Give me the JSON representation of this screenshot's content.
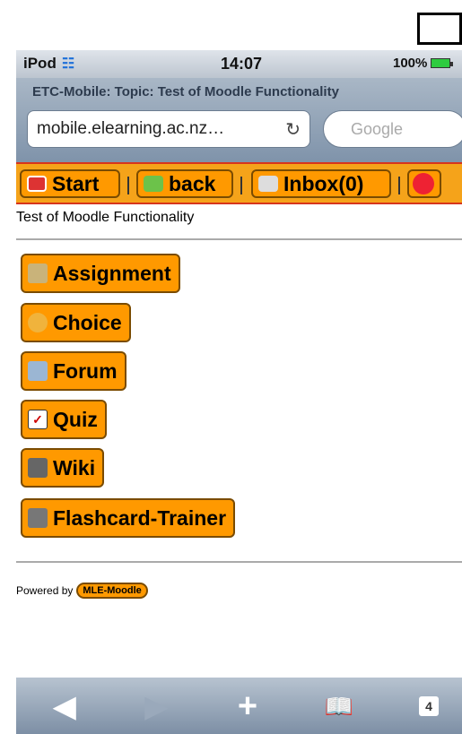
{
  "status_bar": {
    "carrier": "iPod",
    "time": "14:07",
    "battery": "100%"
  },
  "browser": {
    "page_title": "ETC-Mobile: Topic: Test of Moodle Functionality",
    "url": "mobile.elearning.ac.nz…",
    "search_placeholder": "Google"
  },
  "nav": {
    "start": "Start",
    "back": "back",
    "inbox": "Inbox(0)"
  },
  "subtitle": "Test of Moodle Functionality",
  "modules": [
    {
      "label": "Assignment",
      "icon": "assignment-icon",
      "color": "#c9b37a"
    },
    {
      "label": "Choice",
      "icon": "choice-icon",
      "color": "#f0b33c"
    },
    {
      "label": "Forum",
      "icon": "forum-icon",
      "color": "#9bb6d3"
    },
    {
      "label": "Quiz",
      "icon": "quiz-icon",
      "color": "#ffffff"
    },
    {
      "label": "Wiki",
      "icon": "wiki-icon",
      "color": "#666666"
    },
    {
      "label": "Flashcard-Trainer",
      "icon": "flashcard-icon",
      "color": "#777777"
    }
  ],
  "footer": {
    "powered_by": "Powered by",
    "badge": "MLE-Moodle"
  },
  "toolbar": {
    "tabs_count": "4"
  }
}
